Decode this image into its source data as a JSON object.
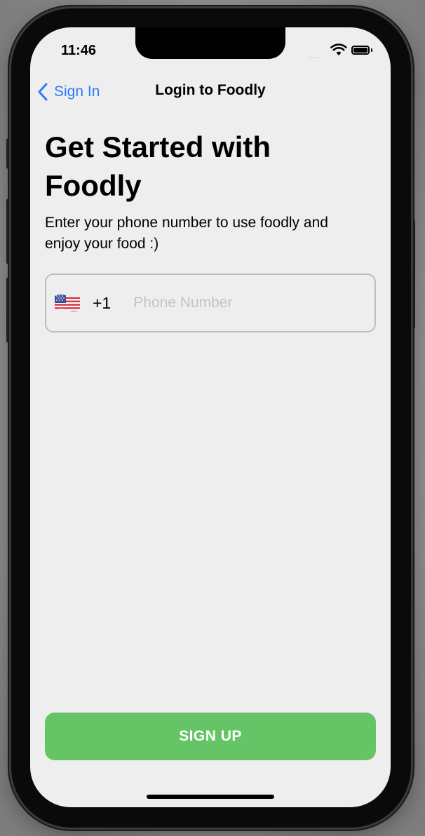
{
  "status_bar": {
    "time": "11:46",
    "signal_text": "....",
    "signal_icon": "cellular-dots-icon",
    "wifi_icon": "wifi-icon",
    "battery_icon": "battery-icon"
  },
  "nav": {
    "back_label": "Sign In",
    "back_icon": "chevron-left-icon",
    "title": "Login to Foodly"
  },
  "main": {
    "heading": "Get Started with Foodly",
    "subtitle": "Enter your phone number to use foodly and enjoy your food :)",
    "phone": {
      "flag_icon": "us-flag-icon",
      "country_code": "+1",
      "placeholder": "Phone Number",
      "value": ""
    }
  },
  "footer": {
    "signup_label": "SIGN UP"
  },
  "colors": {
    "accent": "#2f7cf6",
    "button": "#65c466",
    "background": "#eeeeee"
  }
}
